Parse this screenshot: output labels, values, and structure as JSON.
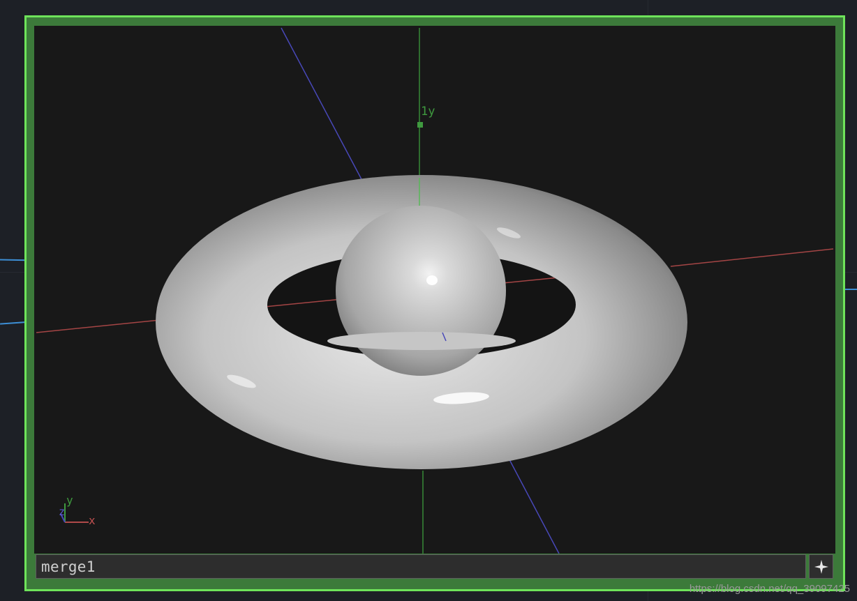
{
  "node": {
    "name": "merge1"
  },
  "viewport": {
    "axis_label_y_tick": "1y",
    "gizmo": {
      "y_label": "y",
      "z_label": "z",
      "x_label": "x"
    },
    "objects": [
      "torus",
      "sphere"
    ]
  },
  "controls": {
    "viewer_toggle_icon": "four-point-star-icon"
  },
  "watermark": "https://blog.csdn.net/qq_39097425",
  "colors": {
    "node_border": "#6ee35a",
    "wire": "#3d8fd6",
    "x_axis": "#b04a4a",
    "y_axis": "#3f9a3f",
    "z_axis": "#4848b8"
  }
}
